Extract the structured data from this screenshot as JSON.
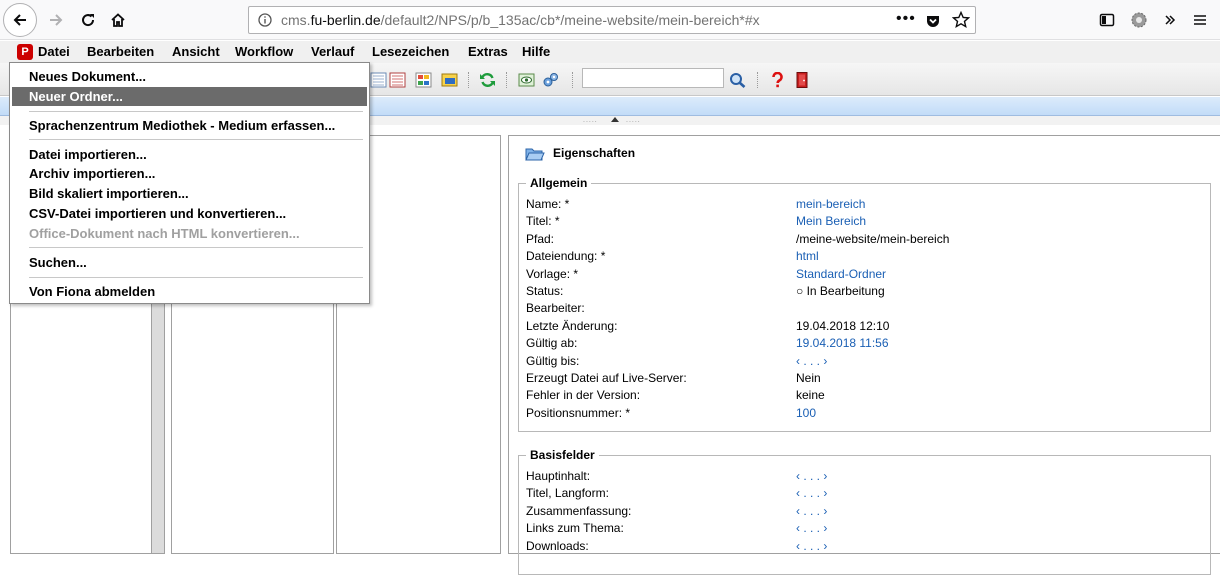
{
  "browser": {
    "url_prefix": "cms.",
    "url_host": "fu-berlin.de",
    "url_path": "/default2/NPS/p/b_135ac/cb*/meine-website/mein-bereich*#x",
    "more_label": "•••"
  },
  "app": {
    "logo_text": "P"
  },
  "menubar": {
    "items": [
      "Datei",
      "Bearbeiten",
      "Ansicht",
      "Workflow",
      "Verlauf",
      "Lesezeichen",
      "Extras",
      "Hilfe"
    ]
  },
  "dropdown": {
    "items": [
      {
        "label": "Neues Dokument...",
        "state": "normal"
      },
      {
        "label": "Neuer Ordner...",
        "state": "active"
      },
      {
        "label": "Sprachenzentrum Mediothek - Medium erfassen...",
        "state": "normal"
      },
      {
        "label": "Datei importieren...",
        "state": "normal"
      },
      {
        "label": "Archiv importieren...",
        "state": "normal"
      },
      {
        "label": "Bild skaliert importieren...",
        "state": "normal"
      },
      {
        "label": "CSV-Datei importieren und konvertieren...",
        "state": "normal"
      },
      {
        "label": "Office-Dokument nach HTML konvertieren...",
        "state": "disabled"
      },
      {
        "label": "Suchen...",
        "state": "normal"
      },
      {
        "label": "Von Fiona abmelden",
        "state": "normal"
      }
    ]
  },
  "properties": {
    "title": "Eigenschaften",
    "allgemein": {
      "legend": "Allgemein",
      "rows": [
        {
          "label": "Name: *",
          "value": "mein-bereich",
          "link": true
        },
        {
          "label": "Titel: *",
          "value": "Mein Bereich",
          "link": true
        },
        {
          "label": "Pfad:",
          "value": "/meine-website/mein-bereich",
          "link": false
        },
        {
          "label": "Dateiendung: *",
          "value": "html",
          "link": true
        },
        {
          "label": "Vorlage: *",
          "value": "Standard-Ordner",
          "link": true
        },
        {
          "label": "Status:",
          "value": "○ In Bearbeitung",
          "link": false
        },
        {
          "label": "Bearbeiter:",
          "value": "",
          "link": false
        },
        {
          "label": "Letzte Änderung:",
          "value": "19.04.2018 12:10",
          "link": false
        },
        {
          "label": "Gültig ab:",
          "value": "19.04.2018 11:56",
          "link": true
        },
        {
          "label": "Gültig bis:",
          "value": "‹ . . . ›",
          "link": true
        },
        {
          "label": "Erzeugt Datei auf Live-Server:",
          "value": "Nein",
          "link": false
        },
        {
          "label": "Fehler in der Version:",
          "value": "keine",
          "link": false
        },
        {
          "label": "Positionsnummer: *",
          "value": "100",
          "link": true
        }
      ]
    },
    "basis": {
      "legend": "Basisfelder",
      "rows": [
        {
          "label": "Hauptinhalt:",
          "value": "‹ . . . ›",
          "link": true
        },
        {
          "label": "Titel, Langform:",
          "value": "‹ . . . ›",
          "link": true
        },
        {
          "label": "Zusammenfassung:",
          "value": "‹ . . . ›",
          "link": true
        },
        {
          "label": "Links zum Thema:",
          "value": "‹ . . . ›",
          "link": true
        },
        {
          "label": "Downloads:",
          "value": "‹ . . . ›",
          "link": true
        }
      ]
    }
  }
}
